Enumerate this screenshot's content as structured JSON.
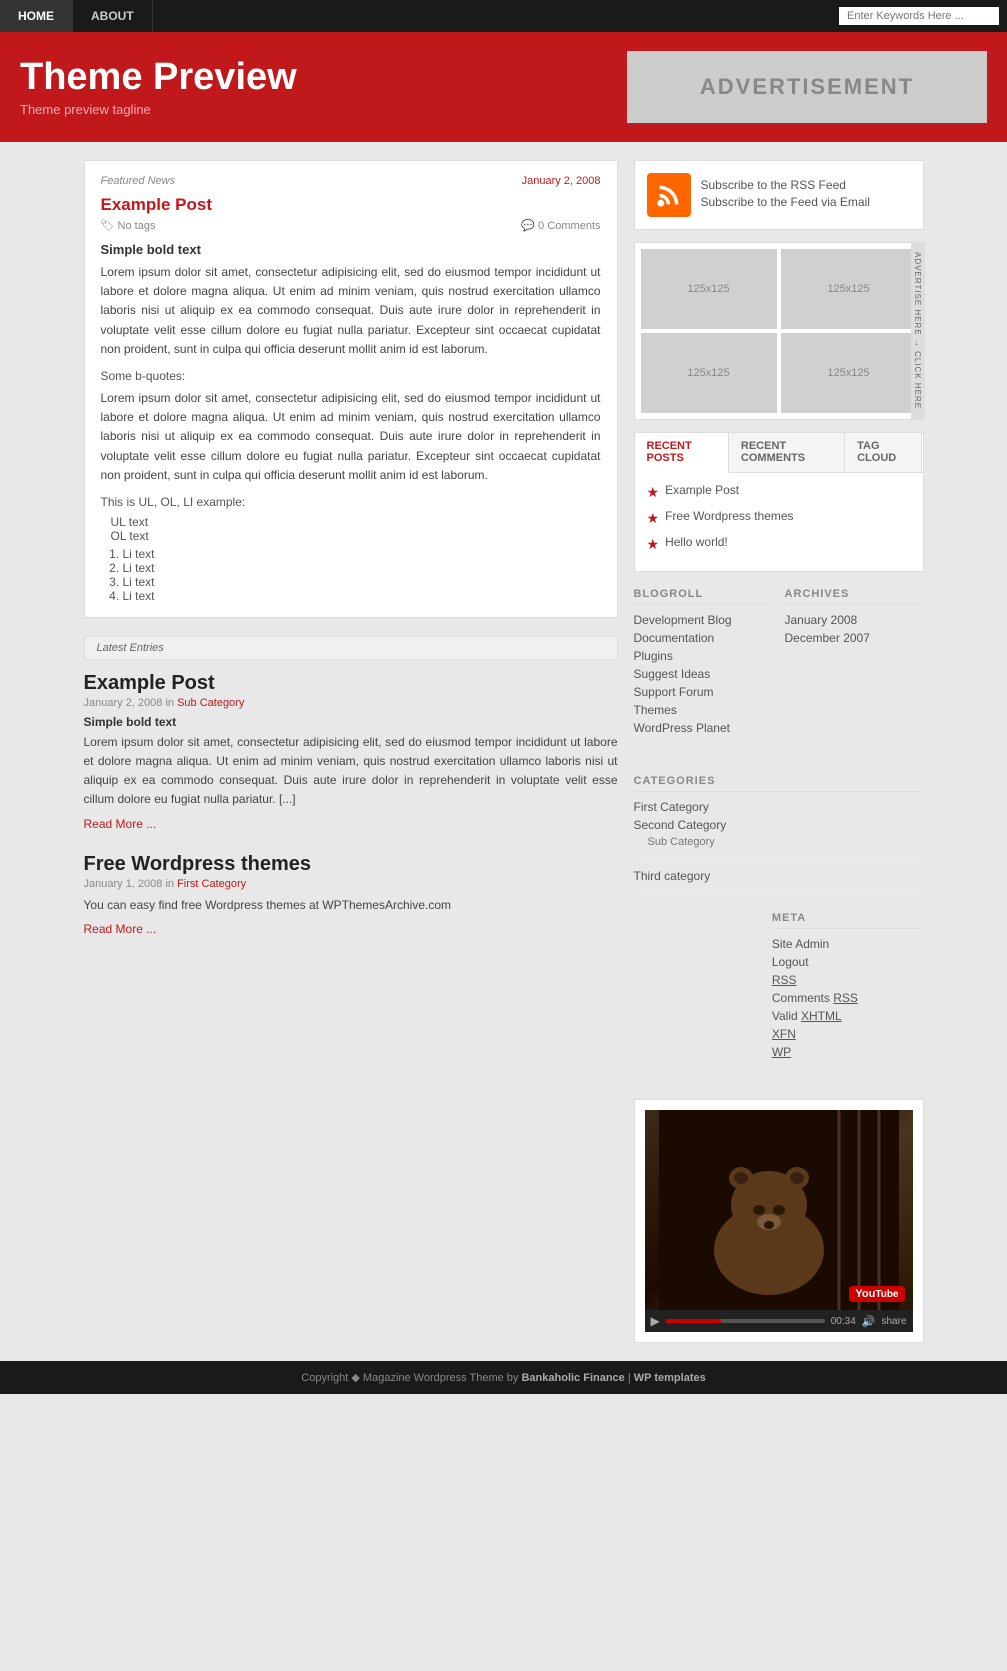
{
  "nav": {
    "items": [
      {
        "label": "HOME",
        "active": true
      },
      {
        "label": "ABOUT",
        "active": false
      }
    ],
    "search_placeholder": "Enter Keywords Here ..."
  },
  "header": {
    "title": "Theme Preview",
    "tagline": "Theme preview tagline",
    "ad_text": "ADVERTISEMENT"
  },
  "featured": {
    "label": "Featured News",
    "date": "January 2, 2008",
    "title": "Example Post",
    "tags": "No tags",
    "comments": "0 Comments",
    "bold_text": "Simple bold text",
    "body1": "Lorem ipsum dolor sit amet, consectetur adipisicing elit, sed do eiusmod tempor incididunt ut labore et dolore magna aliqua. Ut enim ad minim veniam, quis nostrud exercitation ullamco laboris nisi ut aliquip ex ea commodo consequat. Duis aute irure dolor in reprehenderit in voluptate velit esse cillum dolore eu fugiat nulla pariatur. Excepteur sint occaecat cupidatat non proident, sunt in culpa qui officia deserunt mollit anim id est laborum.",
    "blockquote_label": "Some b-quotes:",
    "body2": "Lorem ipsum dolor sit amet, consectetur adipisicing elit, sed do eiusmod tempor incididunt ut labore et dolore magna aliqua. Ut enim ad minim veniam, quis nostrud exercitation ullamco laboris nisi ut aliquip ex ea commodo consequat. Duis aute irure dolor in reprehenderit in voluptate velit esse cillum dolore eu fugiat nulla pariatur. Excepteur sint occaecat cupidatat non proident, sunt in culpa qui officia deserunt mollit anim id est laborum.",
    "list_label": "This is UL, OL, LI example:",
    "ul_items": [
      "UL text",
      "OL text"
    ],
    "ol_items": [
      "Li text",
      "Li text",
      "Li text",
      "Li text"
    ]
  },
  "latest": {
    "section_label": "Latest Entries",
    "posts": [
      {
        "title": "Example Post",
        "date": "January 2, 2008",
        "in_text": "in",
        "category": "Sub Category",
        "bold": "Simple bold text",
        "body": "Lorem ipsum dolor sit amet, consectetur adipisicing elit, sed do eiusmod tempor incididunt ut labore et dolore magna aliqua. Ut enim ad minim veniam, quis nostrud exercitation ullamco laboris nisi ut aliquip ex ea commodo consequat. Duis aute irure dolor in reprehenderit in voluptate velit esse cillum dolore eu fugiat nulla pariatur. [...]",
        "read_more": "Read More ..."
      },
      {
        "title": "Free Wordpress themes",
        "date": "January 1, 2008",
        "in_text": "in",
        "category": "First Category",
        "bold": "",
        "body": "You can easy find free Wordpress themes at WPThemesArchive.com",
        "read_more": "Read More ..."
      }
    ]
  },
  "sidebar": {
    "rss": {
      "subscribe_rss": "Subscribe to the RSS Feed",
      "subscribe_email": "Subscribe to the Feed via Email"
    },
    "ad_grid": {
      "slots": [
        "125x125",
        "125x125",
        "125x125",
        "125x125"
      ],
      "label": "ADVERTISE HERE → CLICK HERE"
    },
    "tabs": {
      "buttons": [
        "RECENT POSTS",
        "RECENT COMMENTS",
        "TAG CLOUD"
      ],
      "active": "RECENT POSTS",
      "posts": [
        "Example Post",
        "Free Wordpress themes",
        "Hello world!"
      ]
    },
    "blogroll": {
      "title": "BLOGROLL",
      "links": [
        "Development Blog",
        "Documentation",
        "Plugins",
        "Suggest Ideas",
        "Support Forum",
        "Themes",
        "WordPress Planet"
      ]
    },
    "archives": {
      "title": "ARCHIVES",
      "links": [
        "January 2008",
        "December 2007"
      ]
    },
    "categories": {
      "title": "CATEGORIES",
      "items": [
        {
          "label": "First Category",
          "children": []
        },
        {
          "label": "Second Category",
          "children": [
            "Sub Category"
          ]
        },
        {
          "label": "Third category",
          "children": []
        }
      ]
    },
    "meta": {
      "title": "META",
      "links": [
        "Site Admin",
        "Logout",
        "RSS",
        "Comments RSS",
        "Valid XHTML",
        "XFN",
        "WP"
      ]
    },
    "youtube": {
      "progress_pct": 35,
      "time": "00:34"
    }
  },
  "footer": {
    "text": "Copyright",
    "symbol": "◆",
    "middle": "Magazine Wordpress Theme by",
    "brand": "Bankaholic Finance",
    "separator": "|",
    "link2": "WP templates"
  }
}
